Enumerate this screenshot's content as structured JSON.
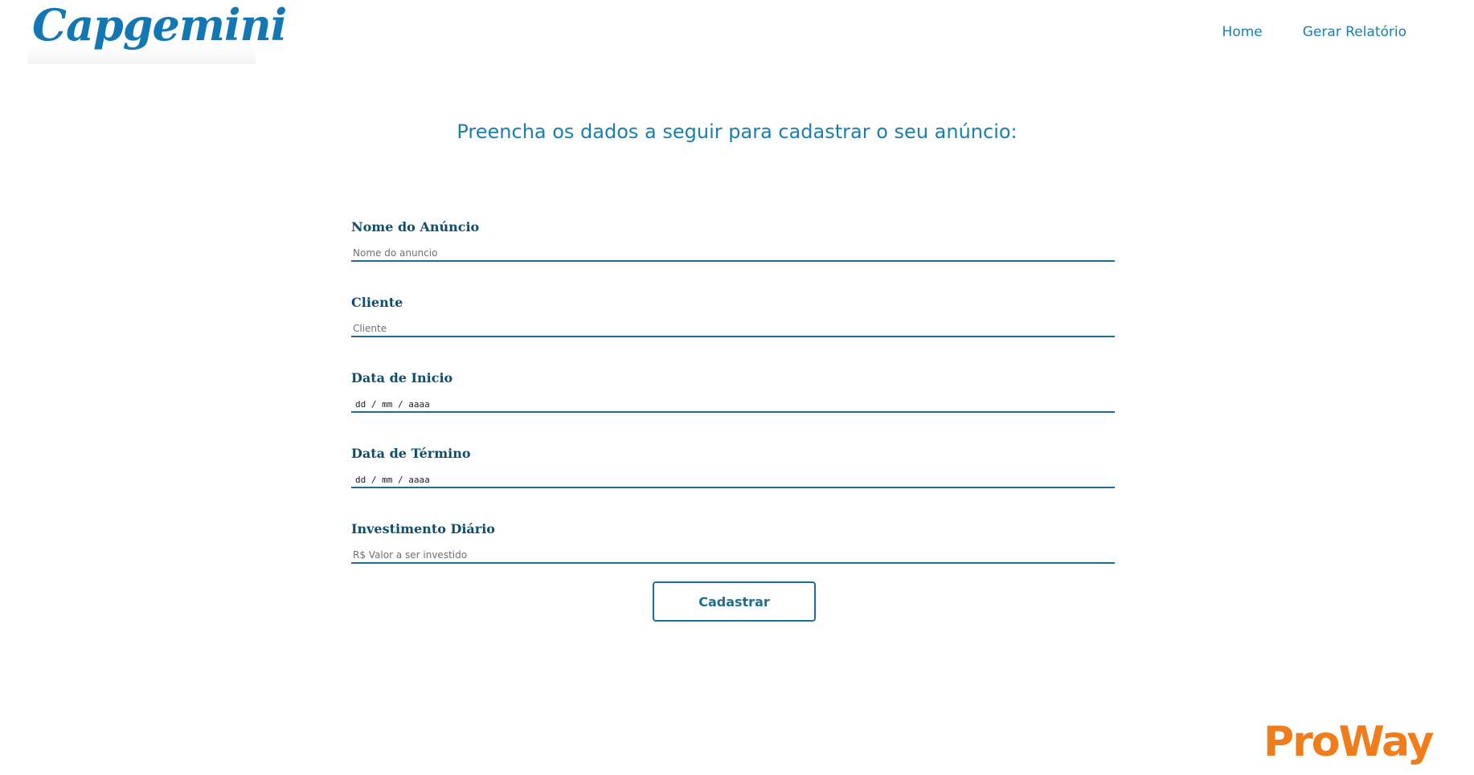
{
  "brand": {
    "logo_text": "Capgemini",
    "partner_logo_text": "ProWay",
    "primary_color": "#1a7fae",
    "accent_color": "#f07c1a"
  },
  "nav": {
    "items": [
      {
        "label": "Home"
      },
      {
        "label": "Gerar Relatório"
      }
    ]
  },
  "page": {
    "title": "Preencha os dados a seguir para cadastrar o seu anúncio:"
  },
  "form": {
    "fields": [
      {
        "label": "Nome do Anúncio",
        "placeholder": "Nome do anuncio",
        "value": ""
      },
      {
        "label": "Cliente",
        "placeholder": "Cliente",
        "value": ""
      },
      {
        "label": "Data de Inicio",
        "placeholder": "dd / mm / aaaa",
        "value": "dd / mm / aaaa"
      },
      {
        "label": "Data de Término",
        "placeholder": "dd / mm / aaaa",
        "value": "dd / mm / aaaa"
      },
      {
        "label": "Investimento Diário",
        "placeholder": "R$ Valor a ser investido",
        "value": ""
      }
    ],
    "submit_label": "Cadastrar"
  }
}
